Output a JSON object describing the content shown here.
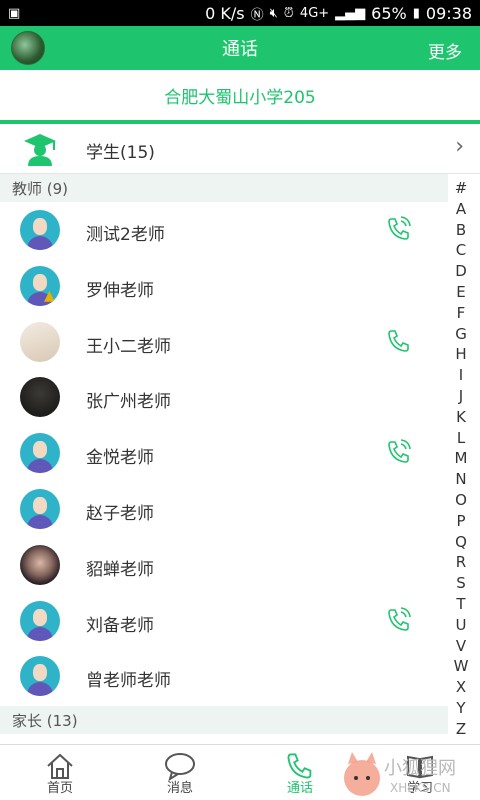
{
  "statusbar": {
    "speed": "0 K/s",
    "network": "4G+",
    "battery": "65%",
    "time": "09:38"
  },
  "header": {
    "title": "通话",
    "more_label": "更多"
  },
  "school": {
    "name": "合肥大蜀山小学205"
  },
  "students": {
    "label": "学生(15)"
  },
  "sections": {
    "teachers": "教师 (9)",
    "parents": "家长 (13)"
  },
  "teachers": [
    {
      "name": "测试2老师",
      "avatar": "default",
      "phone": "wave"
    },
    {
      "name": "罗伸老师",
      "avatar": "default-warn",
      "phone": ""
    },
    {
      "name": "王小二老师",
      "avatar": "photo1",
      "phone": "plain"
    },
    {
      "name": "张广州老师",
      "avatar": "photo2",
      "phone": ""
    },
    {
      "name": "金悦老师",
      "avatar": "default",
      "phone": "wave"
    },
    {
      "name": "赵子老师",
      "avatar": "default",
      "phone": ""
    },
    {
      "name": "貂蝉老师",
      "avatar": "photo3",
      "phone": ""
    },
    {
      "name": "刘备老师",
      "avatar": "default",
      "phone": "wave"
    },
    {
      "name": "曾老师老师",
      "avatar": "default",
      "phone": ""
    }
  ],
  "alphabet": [
    "#",
    "A",
    "B",
    "C",
    "D",
    "E",
    "F",
    "G",
    "H",
    "I",
    "J",
    "K",
    "L",
    "M",
    "N",
    "O",
    "P",
    "Q",
    "R",
    "S",
    "T",
    "U",
    "V",
    "W",
    "X",
    "Y",
    "Z"
  ],
  "bottomnav": {
    "home": "首页",
    "messages": "消息",
    "calls": "通话",
    "study": "学习"
  },
  "watermark": {
    "brand": "小狐狸网",
    "domain": "XHLKS.CN"
  },
  "colors": {
    "accent": "#1fc46f",
    "section_bg": "#eef4f1"
  }
}
